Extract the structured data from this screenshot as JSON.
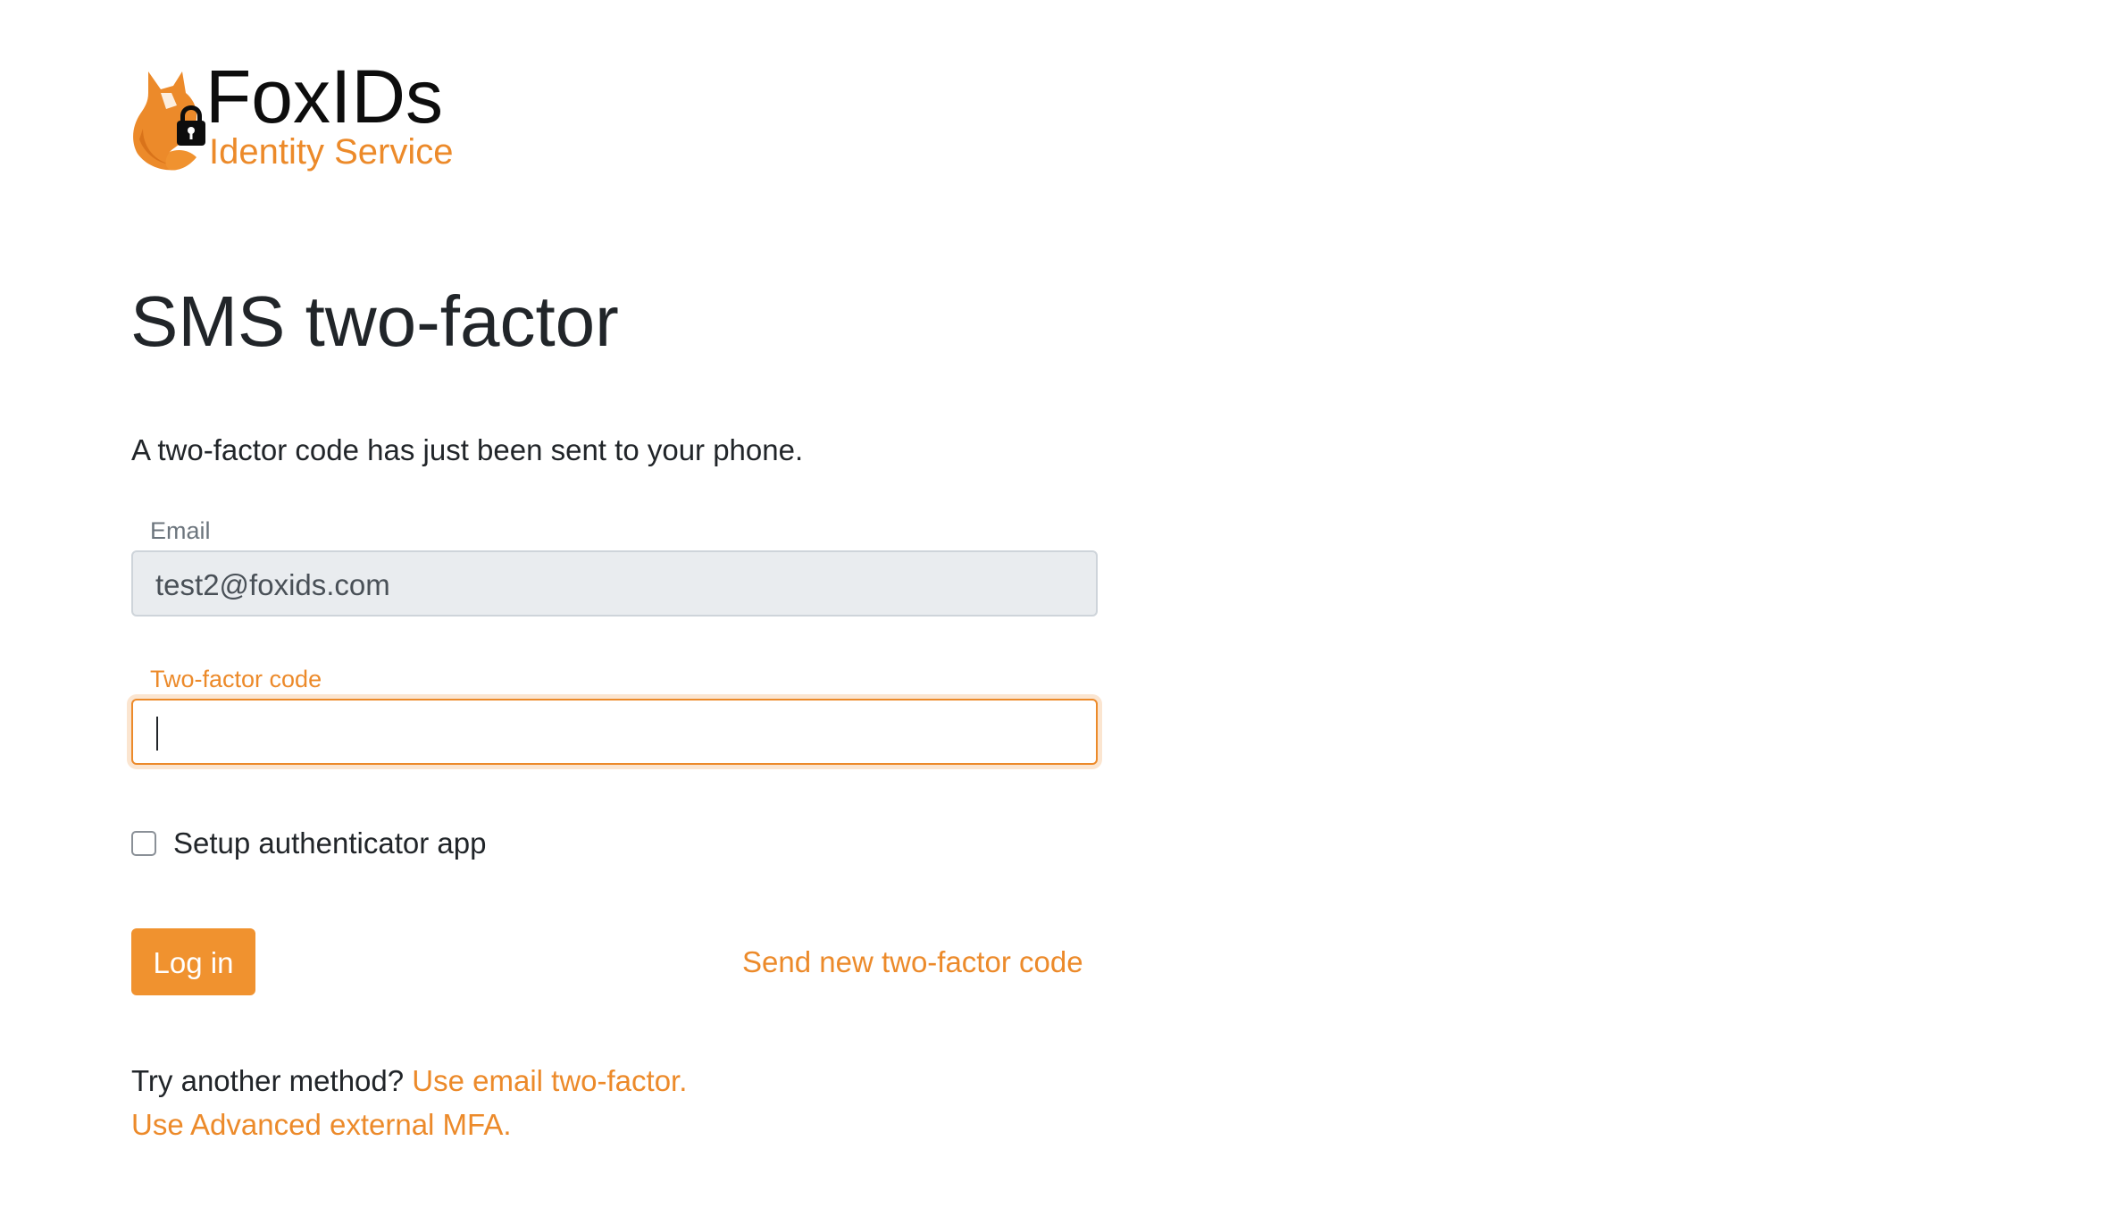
{
  "brand": {
    "name": "FoxIDs",
    "tagline": "Identity Service",
    "accent_color": "#ec8a2a",
    "logo_icon": "fox-lock-icon"
  },
  "page": {
    "title": "SMS two-factor",
    "intro": "A two-factor code has just been sent to your phone."
  },
  "form": {
    "email": {
      "label": "Email",
      "value": "test2@foxids.com",
      "readonly": true
    },
    "code": {
      "label": "Two-factor code",
      "value": "",
      "focused": true
    },
    "setup_authenticator": {
      "label": "Setup authenticator app",
      "checked": false
    },
    "login_button": "Log in",
    "resend_link": "Send new two-factor code"
  },
  "alternatives": {
    "prompt": "Try another method?",
    "email_link": "Use email two-factor.",
    "mfa_link": "Use Advanced external MFA."
  },
  "colors": {
    "button_bg": "#f0922f",
    "link": "#ec8a2a",
    "text": "#212529",
    "readonly_bg": "#e9ecef"
  }
}
